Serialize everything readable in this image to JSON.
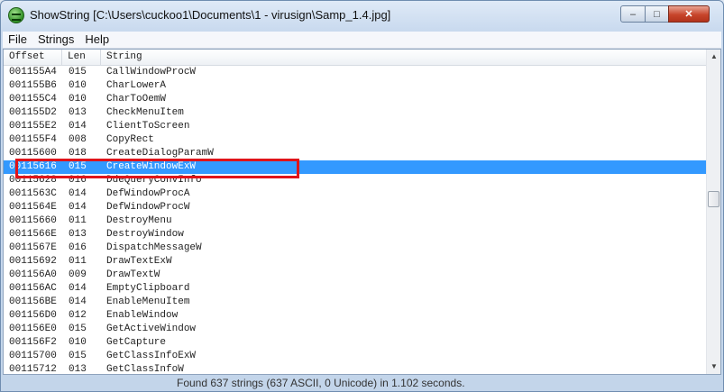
{
  "window": {
    "title": "ShowString  [C:\\Users\\cuckoo1\\Documents\\1 - virusign\\Samp_1.4.jpg]",
    "controls": {
      "minimize": "–",
      "maximize": "□",
      "close": "✕"
    }
  },
  "menu": [
    "File",
    "Strings",
    "Help"
  ],
  "table": {
    "headers": {
      "offset": "Offset",
      "len": "Len",
      "string": "String"
    },
    "rows": [
      {
        "offset": "001155A4",
        "len": "015",
        "string": "CallWindowProcW"
      },
      {
        "offset": "001155B6",
        "len": "010",
        "string": "CharLowerA"
      },
      {
        "offset": "001155C4",
        "len": "010",
        "string": "CharToOemW"
      },
      {
        "offset": "001155D2",
        "len": "013",
        "string": "CheckMenuItem"
      },
      {
        "offset": "001155E2",
        "len": "014",
        "string": "ClientToScreen"
      },
      {
        "offset": "001155F4",
        "len": "008",
        "string": "CopyRect"
      },
      {
        "offset": "00115600",
        "len": "018",
        "string": "CreateDialogParamW"
      },
      {
        "offset": "00115616",
        "len": "015",
        "string": "CreateWindowExW"
      },
      {
        "offset": "00115628",
        "len": "016",
        "string": "DdeQueryConvInfo"
      },
      {
        "offset": "0011563C",
        "len": "014",
        "string": "DefWindowProcA"
      },
      {
        "offset": "0011564E",
        "len": "014",
        "string": "DefWindowProcW"
      },
      {
        "offset": "00115660",
        "len": "011",
        "string": "DestroyMenu"
      },
      {
        "offset": "0011566E",
        "len": "013",
        "string": "DestroyWindow"
      },
      {
        "offset": "0011567E",
        "len": "016",
        "string": "DispatchMessageW"
      },
      {
        "offset": "00115692",
        "len": "011",
        "string": "DrawTextExW"
      },
      {
        "offset": "001156A0",
        "len": "009",
        "string": "DrawTextW"
      },
      {
        "offset": "001156AC",
        "len": "014",
        "string": "EmptyClipboard"
      },
      {
        "offset": "001156BE",
        "len": "014",
        "string": "EnableMenuItem"
      },
      {
        "offset": "001156D0",
        "len": "012",
        "string": "EnableWindow"
      },
      {
        "offset": "001156E0",
        "len": "015",
        "string": "GetActiveWindow"
      },
      {
        "offset": "001156F2",
        "len": "010",
        "string": "GetCapture"
      },
      {
        "offset": "00115700",
        "len": "015",
        "string": "GetClassInfoExW"
      },
      {
        "offset": "00115712",
        "len": "013",
        "string": "GetClassInfoW"
      }
    ],
    "selected_offset": "00115616"
  },
  "status": "Found 637 strings (637 ASCII, 0 Unicode) in 1.102 seconds.",
  "colors": {
    "selection": "#3399ff",
    "highlight_box": "#e0141a"
  }
}
